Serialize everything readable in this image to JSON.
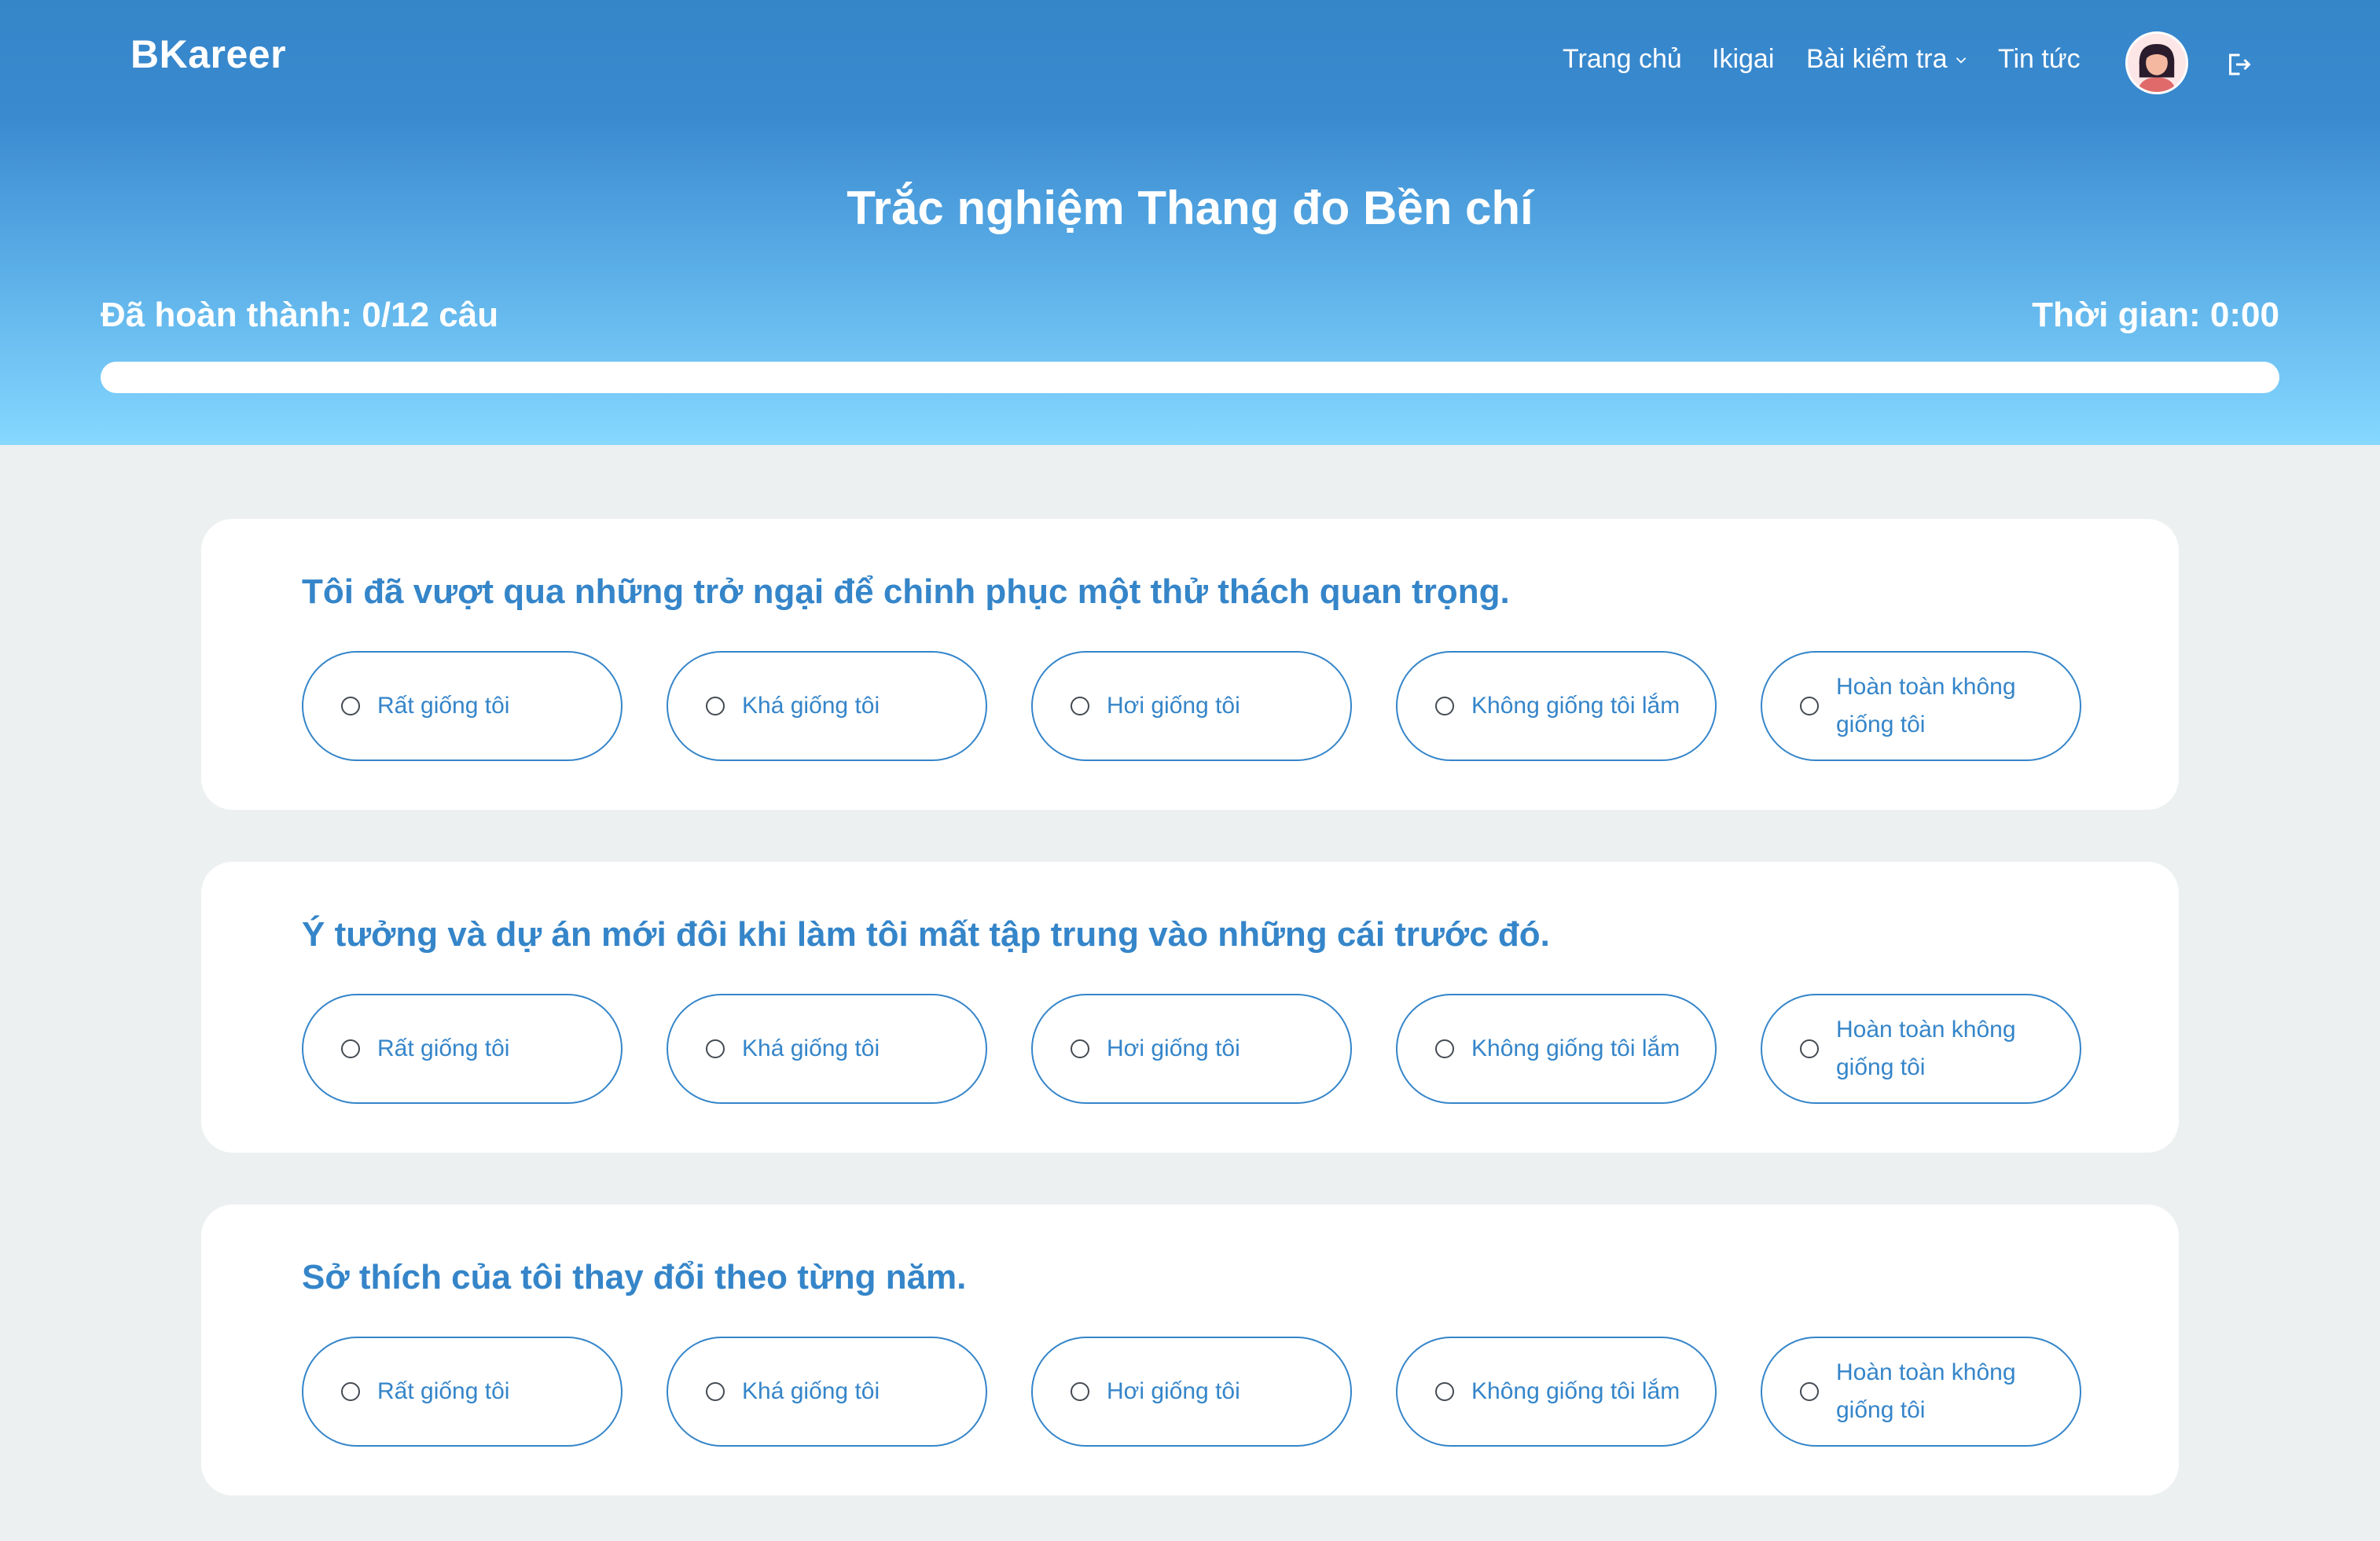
{
  "header": {
    "logo": "BKareer",
    "nav": {
      "home": "Trang chủ",
      "ikigai": "Ikigai",
      "tests": "Bài kiểm tra",
      "news": "Tin tức"
    }
  },
  "hero": {
    "title": "Trắc nghiệm Thang đo Bền chí",
    "progress_label": "Đã hoàn thành: 0/12 câu",
    "timer": "Thời gian: 0:00",
    "progress_fraction": 0
  },
  "questions": [
    {
      "text": "Tôi đã vượt qua những trở ngại để chinh phục một thử thách quan trọng.",
      "options": [
        "Rất giống tôi",
        "Khá giống tôi",
        "Hơi giống tôi",
        "Không giống tôi lắm",
        "Hoàn toàn không giống tôi"
      ]
    },
    {
      "text": "Ý tưởng và dự án mới đôi khi làm tôi mất tập trung vào những cái trước đó.",
      "options": [
        "Rất giống tôi",
        "Khá giống tôi",
        "Hơi giống tôi",
        "Không giống tôi lắm",
        "Hoàn toàn không giống tôi"
      ]
    },
    {
      "text": "Sở thích của tôi thay đổi theo từng năm.",
      "options": [
        "Rất giống tôi",
        "Khá giống tôi",
        "Hơi giống tôi",
        "Không giống tôi lắm",
        "Hoàn toàn không giống tôi"
      ]
    }
  ],
  "colors": {
    "primary": "#3585c9",
    "background": "#edf0f0",
    "card": "#ffffff"
  },
  "icons": {
    "dropdown": "chevron-down-icon",
    "logout": "logout-icon",
    "avatar": "user-avatar"
  }
}
